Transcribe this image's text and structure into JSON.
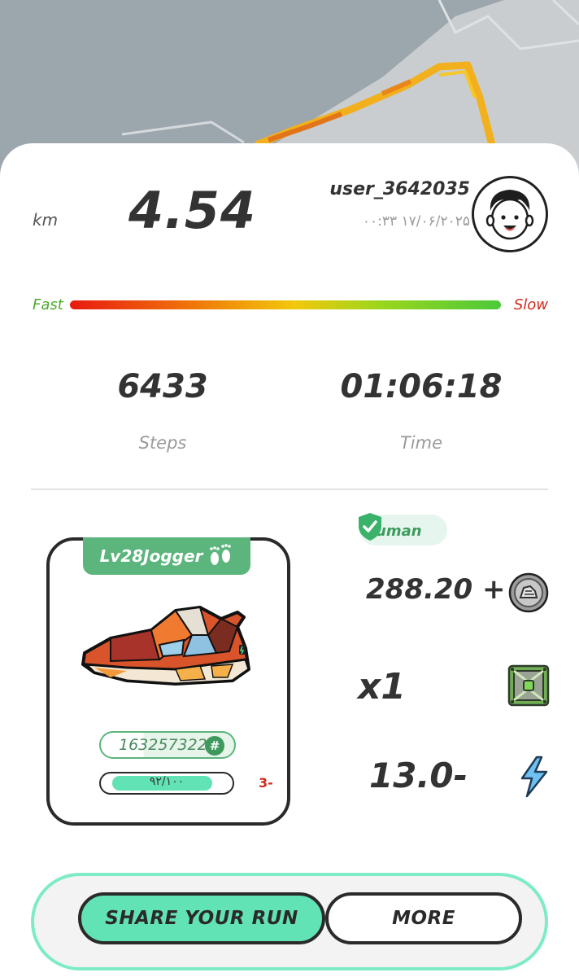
{
  "run": {
    "distance": "4.54",
    "unit": "km",
    "username": "user_3642035",
    "datetime": "۰۰:۳۳ ۱۷/۰۶/۲۰۲۵"
  },
  "speed_scale": {
    "fast_label": "Fast",
    "slow_label": "Slow"
  },
  "stats": {
    "steps_value": "6433",
    "steps_label": "Steps",
    "time_value": "01:06:18",
    "time_label": "Time"
  },
  "sneaker": {
    "level_label": "Lv28Jogger",
    "id": "163257322",
    "hash_symbol": "#",
    "durability_text": "۹۲/۱۰۰",
    "durability_fraction": 0.92,
    "durability_change": "3-"
  },
  "rewards": {
    "badge_label": "uman",
    "gst_value": "288.20 +",
    "multiplier": "x1",
    "energy_change": "13.0-"
  },
  "buttons": {
    "share": "SHARE YOUR RUN",
    "more": "MORE"
  },
  "colors": {
    "accent_mint": "#62e3b5",
    "accent_green": "#5bb57c",
    "fast_green": "#4caa2a",
    "slow_red": "#d02a1c"
  },
  "icons": [
    "avatar-face-icon",
    "footprints-icon",
    "hash-icon",
    "shield-check-icon",
    "coin-icon",
    "mystery-box-icon",
    "lightning-bolt-icon"
  ]
}
